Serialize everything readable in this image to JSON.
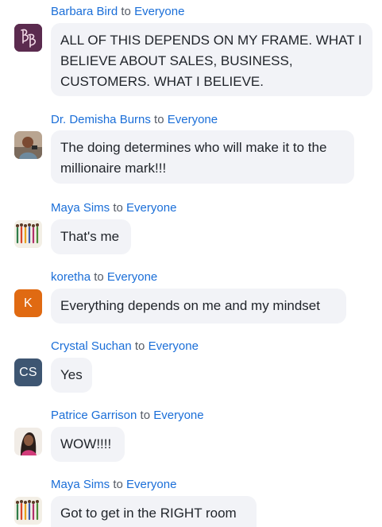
{
  "colors": {
    "name_link": "#1a6ed8",
    "bubble_bg": "#f2f3f7",
    "avatar_koretha": "#e06a12",
    "avatar_crystal": "#3e5672"
  },
  "messages": [
    {
      "sender": "Barbara Bird",
      "to_word": "to",
      "recipient": "Everyone",
      "text": "ALL OF THIS DEPENDS ON MY FRAME. WHAT I BELIEVE ABOUT SALES, BUSINESS, CUSTOMERS. WHAT I BELIEVE.",
      "avatar": "bb-monogram-logo"
    },
    {
      "sender": "Dr. Demisha Burns",
      "to_word": "to",
      "recipient": "Everyone",
      "text": "The doing determines who will make it to the millionaire mark!!!",
      "avatar": "profile-photo"
    },
    {
      "sender": "Maya Sims",
      "to_word": "to",
      "recipient": "Everyone",
      "text": "That's me",
      "avatar": "group-illustration"
    },
    {
      "sender": "koretha",
      "to_word": "to",
      "recipient": "Everyone",
      "text": "Everything depends on me and my mindset",
      "avatar": "initial",
      "initials": "K"
    },
    {
      "sender": "Crystal Suchan",
      "to_word": "to",
      "recipient": "Everyone",
      "text": "Yes",
      "avatar": "initial",
      "initials": "CS"
    },
    {
      "sender": "Patrice Garrison",
      "to_word": "to",
      "recipient": "Everyone",
      "text": "WOW!!!!",
      "avatar": "profile-photo"
    },
    {
      "sender": "Maya Sims",
      "to_word": "to",
      "recipient": "Everyone",
      "text": "Got to get in the RIGHT room",
      "avatar": "group-illustration"
    }
  ]
}
